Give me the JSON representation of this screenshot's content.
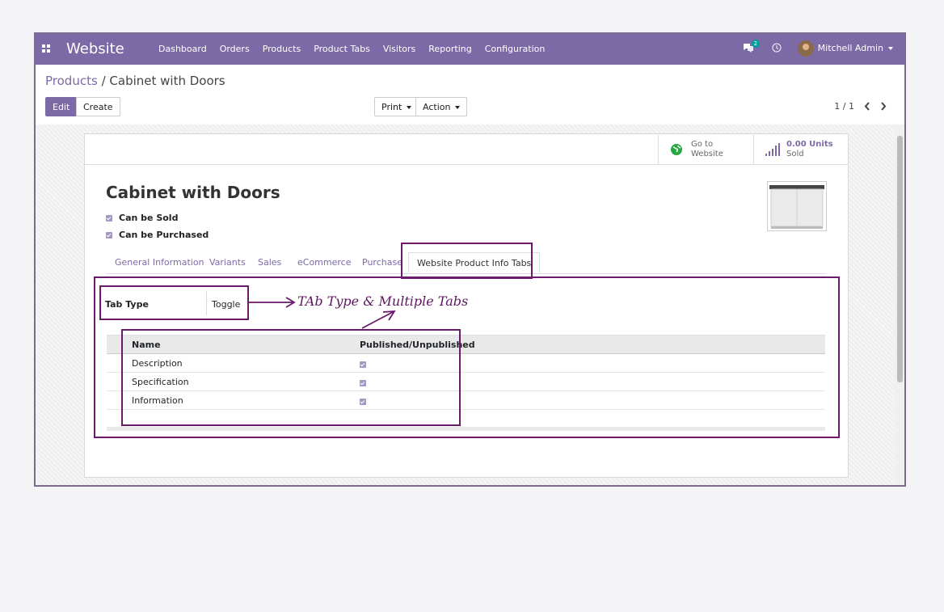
{
  "navbar": {
    "brand": "Website",
    "menu": [
      "Dashboard",
      "Orders",
      "Products",
      "Product Tabs",
      "Visitors",
      "Reporting",
      "Configuration"
    ],
    "chat_count": "2",
    "user": "Mitchell Admin"
  },
  "breadcrumb": {
    "parent": "Products",
    "separator": "/",
    "current": "Cabinet with Doors"
  },
  "toolbar": {
    "edit": "Edit",
    "create": "Create",
    "print": "Print",
    "action": "Action"
  },
  "pager": {
    "value": "1 / 1"
  },
  "smart_buttons": {
    "website_line1": "Go to",
    "website_line2": "Website",
    "sold_value": "0.00 Units",
    "sold_label": "Sold"
  },
  "product": {
    "name": "Cabinet with Doors",
    "can_be_sold": "Can be Sold",
    "can_be_purchased": "Can be Purchased"
  },
  "tabs": [
    "General Information",
    "Variants",
    "Sales",
    "eCommerce",
    "Purchase",
    "Website Product Info Tabs"
  ],
  "tab_type": {
    "label": "Tab Type",
    "value": "Toggle"
  },
  "table": {
    "headers": [
      "Name",
      "Published/Unpublished"
    ],
    "rows": [
      {
        "name": "Description",
        "published": true
      },
      {
        "name": "Specification",
        "published": true
      },
      {
        "name": "Information",
        "published": true
      }
    ]
  },
  "annotation": "TAb Type & Multiple Tabs",
  "colors": {
    "brand": "#7c6aa6",
    "highlight": "#6b1a6b"
  }
}
